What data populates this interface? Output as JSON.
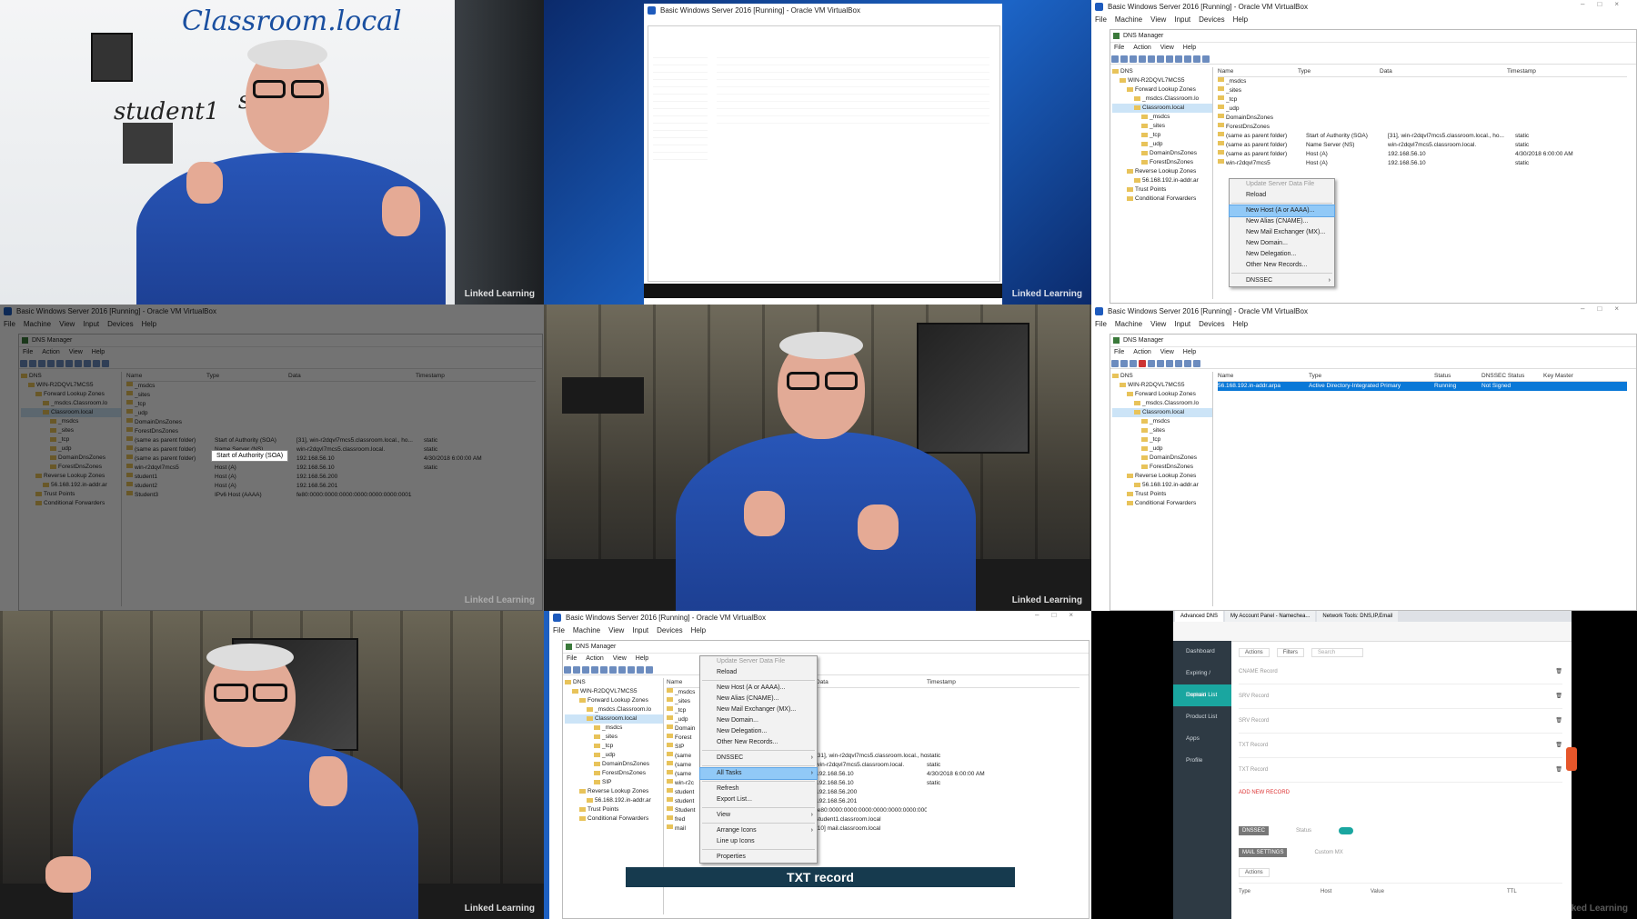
{
  "watermark": "Linked",
  "watermark2": "Learning",
  "whiteboard": {
    "line1": "Classroom.local",
    "line2": "student1",
    "line3": "stu"
  },
  "vm": {
    "title": "Basic Windows Server 2016 [Running] - Oracle VM VirtualBox",
    "menu": [
      "File",
      "Machine",
      "View",
      "Input",
      "Devices",
      "Help"
    ],
    "dns_title": "DNS Manager",
    "dns_menu": [
      "File",
      "Action",
      "View",
      "Help"
    ],
    "tree_t3": [
      "DNS",
      "WIN-R2DQVL7MCS5",
      "Forward Lookup Zones",
      "_msdcs.Classroom.lo",
      "Classroom.local",
      "_msdcs",
      "_sites",
      "_tcp",
      "_udp",
      "DomainDnsZones",
      "ForestDnsZones",
      "Reverse Lookup Zones",
      "56.168.192.in-addr.ar",
      "Trust Points",
      "Conditional Forwarders"
    ],
    "tree_t8": [
      "DNS",
      "WIN-R2DQVL7MCS5",
      "Forward Lookup Zones",
      "_msdcs.Classroom.lo",
      "Classroom.local",
      "_msdcs",
      "_sites",
      "_tcp",
      "_udp",
      "DomainDnsZones",
      "ForestDnsZones",
      "SIP",
      "Reverse Lookup Zones",
      "56.168.192.in-addr.ar",
      "Trust Points",
      "Conditional Forwarders"
    ],
    "list_headers": [
      "Name",
      "Type",
      "Data",
      "Timestamp"
    ],
    "rows_t3": [
      [
        "_msdcs",
        "",
        "",
        ""
      ],
      [
        "_sites",
        "",
        "",
        ""
      ],
      [
        "_tcp",
        "",
        "",
        ""
      ],
      [
        "_udp",
        "",
        "",
        ""
      ],
      [
        "DomainDnsZones",
        "",
        "",
        ""
      ],
      [
        "ForestDnsZones",
        "",
        "",
        ""
      ],
      [
        "(same as parent folder)",
        "Start of Authority (SOA)",
        "[31], win-r2dqvl7mcs5.classroom.local., ho...",
        "static"
      ],
      [
        "(same as parent folder)",
        "Name Server (NS)",
        "win-r2dqvl7mcs5.classroom.local.",
        "static"
      ],
      [
        "(same as parent folder)",
        "Host (A)",
        "192.168.56.10",
        "4/30/2018 6:00:00 AM"
      ],
      [
        "win-r2dqvl7mcs5",
        "Host (A)",
        "192.168.56.10",
        "static"
      ]
    ],
    "rows_t4": [
      [
        "_msdcs",
        "",
        "",
        ""
      ],
      [
        "_sites",
        "",
        "",
        ""
      ],
      [
        "_tcp",
        "",
        "",
        ""
      ],
      [
        "_udp",
        "",
        "",
        ""
      ],
      [
        "DomainDnsZones",
        "",
        "",
        ""
      ],
      [
        "ForestDnsZones",
        "",
        "",
        ""
      ],
      [
        "(same as parent folder)",
        "Start of Authority (SOA)",
        "[31], win-r2dqvl7mcs5.classroom.local., ho...",
        "static"
      ],
      [
        "(same as parent folder)",
        "Name Server (NS)",
        "win-r2dqvl7mcs5.classroom.local.",
        "static"
      ],
      [
        "(same as parent folder)",
        "Host (A)",
        "192.168.56.10",
        "4/30/2018 6:00:00 AM"
      ],
      [
        "win-r2dqvl7mcs5",
        "Host (A)",
        "192.168.56.10",
        "static"
      ],
      [
        "student1",
        "Host (A)",
        "192.168.56.200",
        ""
      ],
      [
        "student2",
        "Host (A)",
        "192.168.56.201",
        ""
      ],
      [
        "Student3",
        "IPv6 Host (AAAA)",
        "fe80:0000:0000:0000:0000:0000:0000:0001",
        ""
      ]
    ],
    "tooltip_t4": "Start of Authority (SOA)",
    "ctx_t3": [
      "Update Server Data File",
      "Reload",
      "New Host (A or AAAA)...",
      "New Alias (CNAME)...",
      "New Mail Exchanger (MX)...",
      "New Domain...",
      "New Delegation...",
      "Other New Records...",
      "DNSSEC"
    ],
    "ctx_t8": [
      "Update Server Data File",
      "Reload",
      "New Host (A or AAAA)...",
      "New Alias (CNAME)...",
      "New Mail Exchanger (MX)...",
      "New Domain...",
      "New Delegation...",
      "Other New Records...",
      "DNSSEC",
      "All Tasks",
      "Refresh",
      "Export List...",
      "View",
      "Arrange Icons",
      "Line up Icons",
      "Properties"
    ],
    "rev_headers": [
      "Name",
      "Type",
      "Status",
      "DNSSEC Status",
      "Key Master"
    ],
    "rev_row": [
      "56.168.192.in-addr.arpa",
      "Active Directory-Integrated Primary",
      "Running",
      "Not Signed",
      ""
    ],
    "rows_t8_data": [
      "[31], win-r2dqvl7mcs5.classroom.local., ho...",
      "win-r2dqvl7mcs5.classroom.local.",
      "192.168.56.10",
      "192.168.56.10",
      "192.168.56.200",
      "192.168.56.201",
      "fe80:0000:0000:0000:0000:0000:0000:0001",
      "student1.classroom.local",
      "[10] mail.classroom.local"
    ],
    "rows_t8_ts": [
      "static",
      "static",
      "4/30/2018 6:00:00 AM",
      "static"
    ],
    "rows_t8_names": [
      "_msdcs",
      "_sites",
      "_tcp",
      "_udp",
      "Domain",
      "Forest",
      "SIP",
      "(same",
      "(same",
      "(same",
      "win-r2c",
      "student",
      "student",
      "Student",
      "fred",
      "mail"
    ]
  },
  "banner": "TXT record",
  "web": {
    "tabs": [
      "Advanced DNS",
      "My Account Panel - Namechea...",
      "Network Tools: DNS,IP,Email"
    ],
    "nav": [
      "Dashboard",
      "Expiring / Expired",
      "Domain List",
      "Product List",
      "Apps",
      "Profile"
    ],
    "toolbar": [
      "Actions",
      "Filters",
      "Search"
    ],
    "records": [
      "CNAME Record",
      "SRV Record",
      "SRV Record",
      "TXT Record",
      "TXT Record"
    ],
    "add_label": "ADD NEW RECORD",
    "dnssec": "DNSSEC",
    "mail": "MAIL SETTINGS",
    "status": "Status",
    "custom_mx": "Custom MX",
    "actions2": "Actions",
    "cols": [
      "Type",
      "Host",
      "Value",
      "TTL"
    ]
  }
}
